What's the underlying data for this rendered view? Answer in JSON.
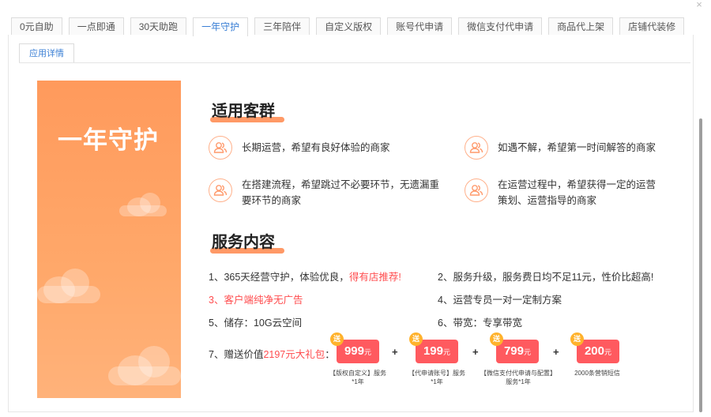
{
  "close_icon": "close-icon",
  "tabs": [
    {
      "label": "0元自助"
    },
    {
      "label": "一点即通"
    },
    {
      "label": "30天助跑"
    },
    {
      "label": "一年守护"
    },
    {
      "label": "三年陪伴"
    },
    {
      "label": "自定义版权"
    },
    {
      "label": "账号代申请"
    },
    {
      "label": "微信支付代申请"
    },
    {
      "label": "商品代上架"
    },
    {
      "label": "店铺代装修"
    }
  ],
  "active_tab": 3,
  "subtab": {
    "label": "应用详情"
  },
  "banner": {
    "title": "一年守护",
    "color": "#ff9a5c"
  },
  "audience": {
    "title": "适用客群",
    "items": [
      {
        "text": "长期运营，希望有良好体验的商家"
      },
      {
        "text": "如遇不解，希望第一时间解答的商家"
      },
      {
        "text": "在搭建流程，希望跳过不必要环节，无遗漏重要环节的商家"
      },
      {
        "text": "在运营过程中，希望获得一定的运营策划、运营指导的商家"
      }
    ]
  },
  "services": {
    "title": "服务内容",
    "items": [
      {
        "prefix": "1、365天经营守护，体验优良，",
        "highlight": "得有店推荐!"
      },
      {
        "prefix": "2、服务升级，服务费日均不足11元，性价比超高!",
        "highlight": ""
      },
      {
        "prefix": "3、客户端纯净无广告",
        "highlight": ""
      },
      {
        "prefix": "4、运营专员一对一定制方案",
        "highlight": ""
      },
      {
        "prefix": "5、储存：10G云空间",
        "highlight": ""
      },
      {
        "prefix": "6、带宽：专享带宽",
        "highlight": ""
      }
    ],
    "gift_line": {
      "prefix": "7、赠送价值",
      "highlight": "2197元大礼包",
      "suffix": "："
    }
  },
  "gifts": [
    {
      "amount": "999",
      "unit": "元",
      "tag": "送",
      "caption1": "【版权自定义】服务",
      "caption2": "*1年"
    },
    {
      "amount": "199",
      "unit": "元",
      "tag": "送",
      "caption1": "【代申请账号】服务",
      "caption2": "*1年"
    },
    {
      "amount": "799",
      "unit": "元",
      "tag": "送",
      "caption1": "【微信支付代申请与配置】",
      "caption2": "服务*1年"
    },
    {
      "amount": "200",
      "unit": "元",
      "tag": "送",
      "caption1": "2000条营销短信",
      "caption2": ""
    }
  ],
  "plus_symbol": "+",
  "colors": {
    "accent": "#3a7fd5",
    "orange": "#ff9a5c",
    "red": "#ff4d4f",
    "gift": "#ff5a5f"
  }
}
